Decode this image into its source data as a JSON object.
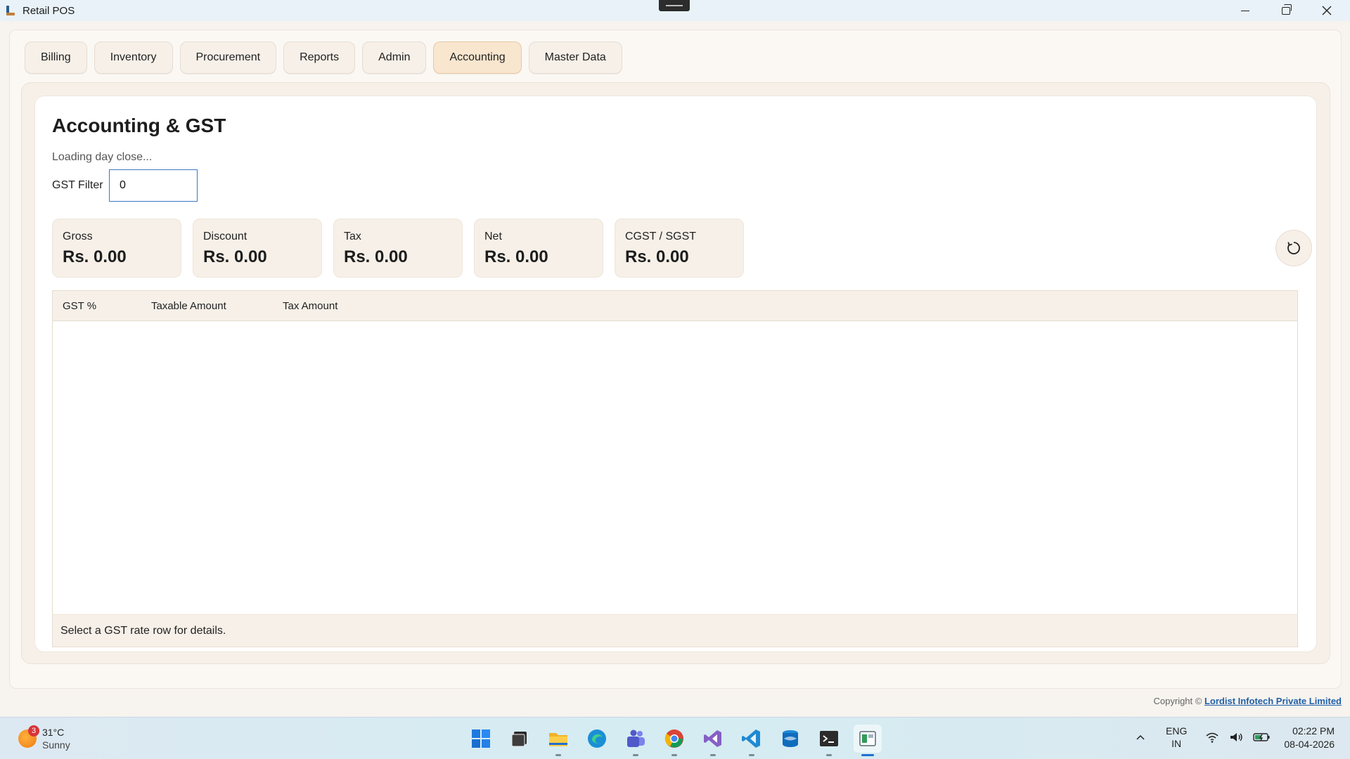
{
  "window": {
    "title": "Retail POS"
  },
  "tabs": [
    {
      "label": "Billing"
    },
    {
      "label": "Inventory"
    },
    {
      "label": "Procurement"
    },
    {
      "label": "Reports"
    },
    {
      "label": "Admin"
    },
    {
      "label": "Accounting",
      "active": true
    },
    {
      "label": "Master Data"
    }
  ],
  "page": {
    "title": "Accounting & GST",
    "status": "Loading day close...",
    "gst_filter_label": "GST Filter",
    "gst_filter_value": "0"
  },
  "cards": [
    {
      "label": "Gross",
      "value": "Rs. 0.00"
    },
    {
      "label": "Discount",
      "value": "Rs. 0.00"
    },
    {
      "label": "Tax",
      "value": "Rs. 0.00"
    },
    {
      "label": "Net",
      "value": "Rs. 0.00"
    },
    {
      "label": "CGST / SGST",
      "value": "Rs. 0.00"
    }
  ],
  "grid": {
    "columns": [
      "GST %",
      "Taxable Amount",
      "Tax Amount"
    ],
    "rows": [],
    "footer": "Select a GST rate row for details."
  },
  "footer": {
    "copyright_prefix": "Copyright ©",
    "company": "Lordist Infotech Private Limited"
  },
  "taskbar": {
    "weather_temp": "31°C",
    "weather_cond": "Sunny",
    "weather_badge": "3",
    "apps": [
      "windows-start-icon",
      "task-view-icon",
      "file-explorer-icon",
      "edge-icon",
      "teams-icon",
      "chrome-icon",
      "visual-studio-icon",
      "vscode-icon",
      "azure-data-studio-icon",
      "terminal-icon",
      "retail-pos-icon"
    ],
    "lang_line1": "ENG",
    "lang_line2": "IN",
    "time": "02:22 PM",
    "date": "08-04-2026"
  },
  "colors": {
    "accent_tab": "#f8e6cf",
    "panel": "#f6f0e8",
    "focus_border": "#3a78c3",
    "link": "#1f5fa8"
  }
}
